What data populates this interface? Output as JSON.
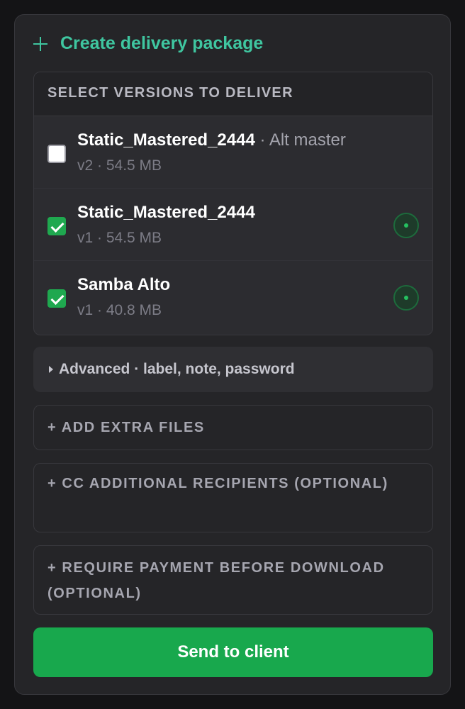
{
  "header": {
    "title": "Create delivery package",
    "icon": "plus-icon",
    "accent": "#3fc6a0"
  },
  "versions": {
    "title": "SELECT VERSIONS TO DELIVER",
    "items": [
      {
        "name": "Static_Mastered_2444",
        "alt": "· Alt master",
        "meta": "v2 · 54.5 MB",
        "checked": false,
        "status": false
      },
      {
        "name": "Static_Mastered_2444",
        "alt": "",
        "meta": "v1 · 54.5 MB",
        "checked": true,
        "status": true
      },
      {
        "name": "Samba Alto",
        "alt": "",
        "meta": "v1 · 40.8 MB",
        "checked": true,
        "status": true
      }
    ]
  },
  "advanced": {
    "label": "Advanced · label, note, password"
  },
  "options": {
    "extra_files": "+ ADD EXTRA FILES",
    "cc_recipients": "+ CC ADDITIONAL RECIPIENTS (OPTIONAL)",
    "require_payment": "+ REQUIRE PAYMENT BEFORE DOWNLOAD (OPTIONAL)"
  },
  "send": {
    "label": "Send to client",
    "color": "#18a84d"
  }
}
